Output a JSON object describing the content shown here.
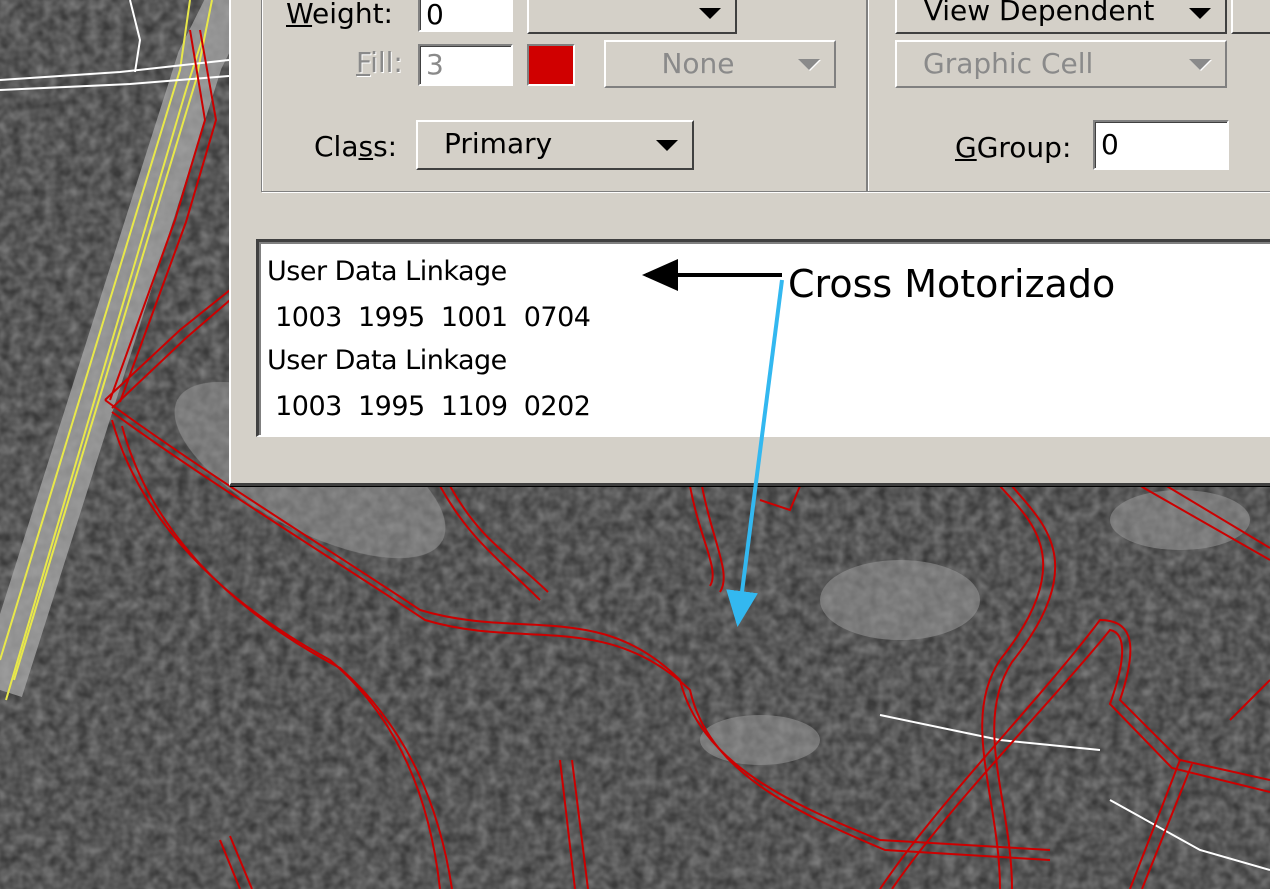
{
  "dialog": {
    "weight": {
      "label": "Weight:",
      "value": "0"
    },
    "fill": {
      "label": "Fill:",
      "value": "3",
      "color": "#d00000",
      "option": "None"
    },
    "class": {
      "label": "Class:",
      "value": "Primary"
    },
    "view_mode": {
      "value": "View Dependent"
    },
    "cell_type": {
      "value": "Graphic Cell"
    },
    "ggroup": {
      "label": "GGroup:",
      "value": "0"
    }
  },
  "linkage_list": {
    "lines": [
      "User Data Linkage",
      " 1003  1995  1001  0704",
      "User Data Linkage",
      " 1003  1995  1109  0202"
    ]
  },
  "annotation": {
    "label": "Cross Motorizado",
    "arrow_to_text_color": "#000000",
    "arrow_to_map_color": "#33b8f0"
  },
  "map": {
    "background": "aerial photograph (grayscale)",
    "trail_color": "#cc0000",
    "road_color": "#e8e84a",
    "path_color": "#ffffff"
  }
}
